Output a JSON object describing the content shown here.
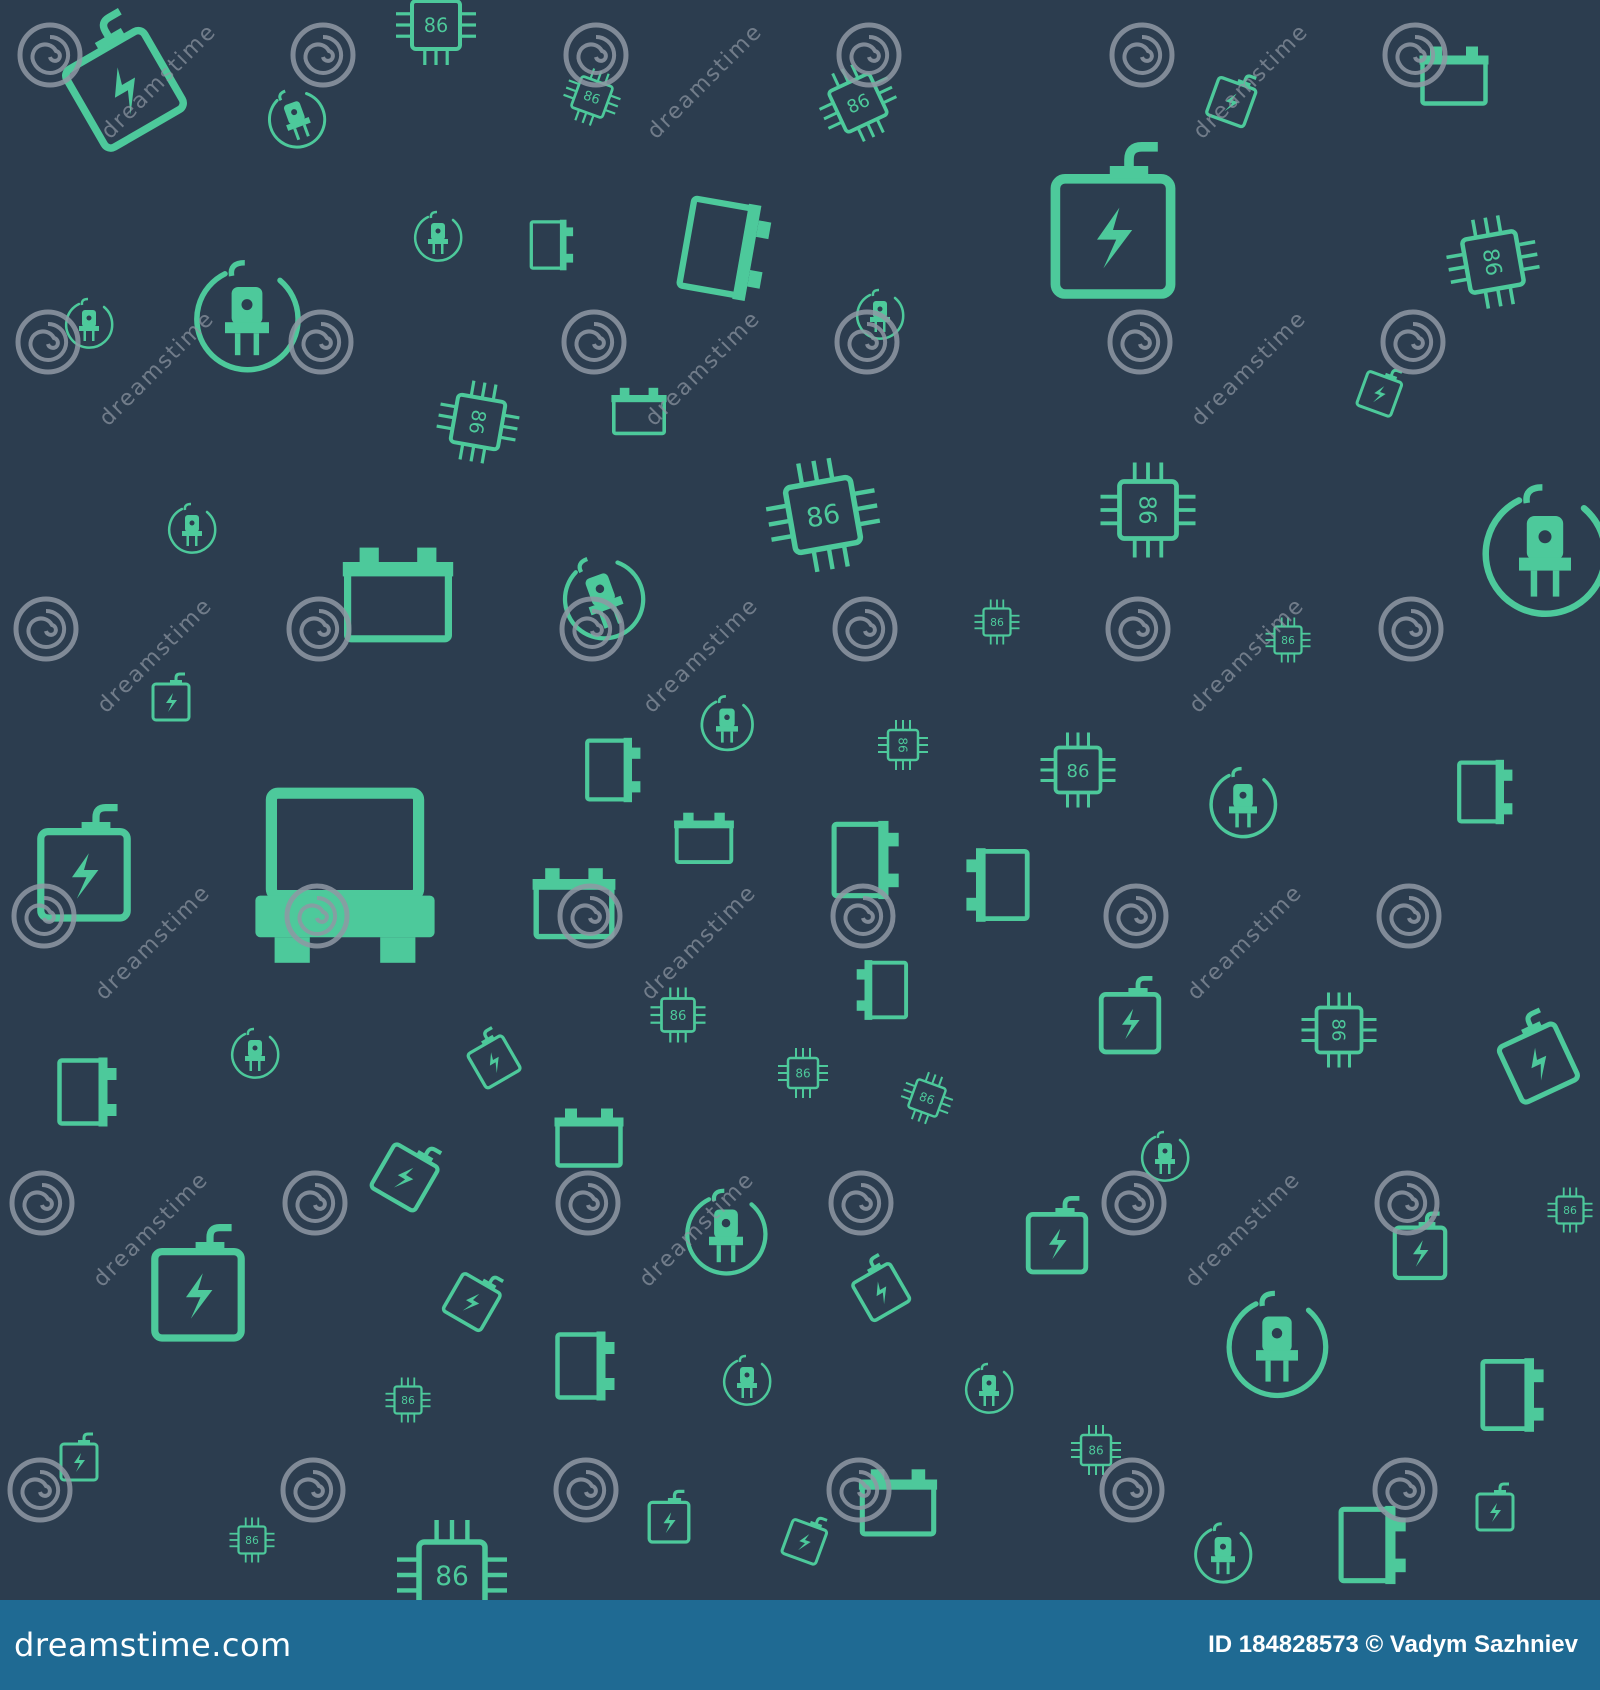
{
  "colors": {
    "background": "#2c3d4f",
    "icon": "#4dc99b",
    "watermark": "#8f98a3",
    "footer_bg": "#1f6a93",
    "footer_text": "#ffffff"
  },
  "pattern": {
    "icon_types": [
      "plug-in-circle-icon",
      "processor-chip-icon",
      "battery-icon",
      "transformer-icon",
      "electric-truck-icon"
    ],
    "chip_label": "86",
    "watermark_text": "dreamstime"
  },
  "footer": {
    "site_text": "dreamstime.com",
    "credit_text": "ID 184828573 © Vadym Sazhniev"
  }
}
